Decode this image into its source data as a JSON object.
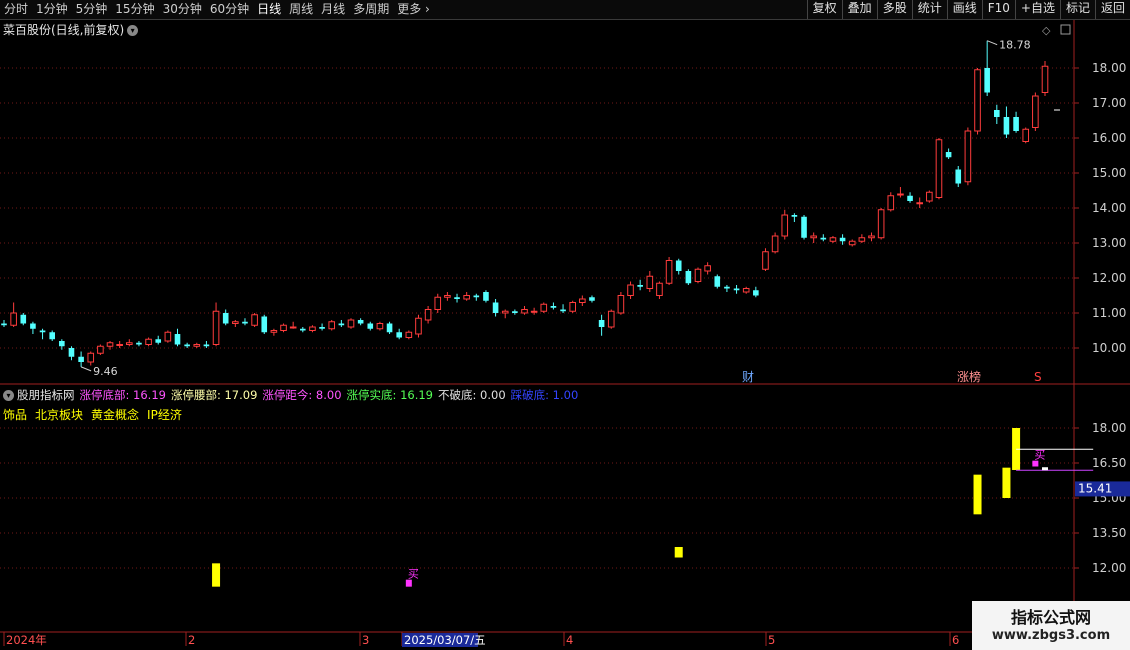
{
  "toolbar": {
    "left": [
      "分时",
      "1分钟",
      "5分钟",
      "15分钟",
      "30分钟",
      "60分钟",
      "日线",
      "周线",
      "月线",
      "多周期",
      "更多"
    ],
    "active": "日线",
    "right": [
      "复权",
      "叠加",
      "多股",
      "统计",
      "画线",
      "F10",
      "+自选",
      "标记",
      "返回"
    ]
  },
  "chart_title": "菜百股份(日线,前复权)",
  "indicator": {
    "name": "股朋指标网",
    "items": [
      {
        "label": "涨停底部:",
        "value": "16.19",
        "color": "#ff55ff"
      },
      {
        "label": "涨停腰部:",
        "value": "17.09",
        "color": "#ffffaa"
      },
      {
        "label": "涨停距今:",
        "value": "8.00",
        "color": "#ff55ff"
      },
      {
        "label": "涨停实底:",
        "value": "16.19",
        "color": "#55ff55"
      },
      {
        "label": "不破底:",
        "value": "0.00",
        "color": "#e0e0e0"
      },
      {
        "label": "踩破底:",
        "value": "1.00",
        "color": "#3344ff"
      }
    ]
  },
  "tags": [
    "饰品",
    "北京板块",
    "黄金概念",
    "IP经济"
  ],
  "annotations": {
    "high": "18.78",
    "low": "9.46",
    "cai": "财",
    "zhangbang": "涨榜",
    "s": "S",
    "buy": "买",
    "current_value": "15.41"
  },
  "watermark": {
    "title": "指标公式网",
    "url": "www.zbgs3.com"
  },
  "chart_data": [
    {
      "type": "candlestick",
      "title": "菜百股份(日线,前复权)",
      "price_axis": {
        "min": 9.4,
        "max": 18.8,
        "ticks": [
          10.0,
          11.0,
          12.0,
          13.0,
          14.0,
          15.0,
          16.0,
          17.0,
          18.0
        ]
      },
      "date_labels": [
        "2024年",
        "2",
        "3",
        "2025/03/07/五",
        "4",
        "5",
        "6"
      ],
      "colors": {
        "up": "#ff3c3c",
        "down": "#54ffff"
      },
      "candles": [
        [
          10.7,
          10.8,
          10.6,
          10.65
        ],
        [
          10.65,
          11.3,
          10.6,
          11.0
        ],
        [
          10.95,
          11.0,
          10.65,
          10.7
        ],
        [
          10.7,
          10.75,
          10.4,
          10.55
        ],
        [
          10.5,
          10.55,
          10.25,
          10.45
        ],
        [
          10.45,
          10.5,
          10.2,
          10.25
        ],
        [
          10.2,
          10.25,
          9.95,
          10.05
        ],
        [
          10.0,
          10.05,
          9.65,
          9.75
        ],
        [
          9.75,
          9.9,
          9.46,
          9.6
        ],
        [
          9.6,
          9.9,
          9.5,
          9.85
        ],
        [
          9.85,
          10.1,
          9.8,
          10.05
        ],
        [
          10.05,
          10.2,
          9.95,
          10.15
        ],
        [
          10.1,
          10.2,
          10.0,
          10.1
        ],
        [
          10.1,
          10.25,
          10.05,
          10.15
        ],
        [
          10.15,
          10.2,
          10.05,
          10.1
        ],
        [
          10.1,
          10.3,
          10.05,
          10.25
        ],
        [
          10.25,
          10.35,
          10.1,
          10.15
        ],
        [
          10.2,
          10.5,
          10.15,
          10.45
        ],
        [
          10.4,
          10.55,
          10.05,
          10.1
        ],
        [
          10.1,
          10.15,
          10.0,
          10.05
        ],
        [
          10.05,
          10.15,
          10.0,
          10.1
        ],
        [
          10.1,
          10.2,
          10.0,
          10.05
        ],
        [
          10.1,
          11.3,
          10.05,
          11.05
        ],
        [
          11.0,
          11.1,
          10.65,
          10.7
        ],
        [
          10.7,
          10.8,
          10.6,
          10.75
        ],
        [
          10.75,
          10.85,
          10.65,
          10.7
        ],
        [
          10.65,
          11.0,
          10.6,
          10.95
        ],
        [
          10.9,
          10.95,
          10.4,
          10.45
        ],
        [
          10.45,
          10.55,
          10.35,
          10.5
        ],
        [
          10.5,
          10.7,
          10.45,
          10.65
        ],
        [
          10.6,
          10.75,
          10.55,
          10.6
        ],
        [
          10.55,
          10.6,
          10.45,
          10.5
        ],
        [
          10.5,
          10.65,
          10.45,
          10.6
        ],
        [
          10.6,
          10.7,
          10.5,
          10.55
        ],
        [
          10.55,
          10.8,
          10.5,
          10.75
        ],
        [
          10.7,
          10.8,
          10.6,
          10.65
        ],
        [
          10.6,
          10.85,
          10.55,
          10.8
        ],
        [
          10.8,
          10.85,
          10.65,
          10.7
        ],
        [
          10.7,
          10.75,
          10.5,
          10.55
        ],
        [
          10.55,
          10.75,
          10.5,
          10.7
        ],
        [
          10.7,
          10.75,
          10.4,
          10.45
        ],
        [
          10.45,
          10.55,
          10.25,
          10.3
        ],
        [
          10.3,
          10.5,
          10.25,
          10.45
        ],
        [
          10.4,
          10.95,
          10.3,
          10.85
        ],
        [
          10.8,
          11.2,
          10.7,
          11.1
        ],
        [
          11.1,
          11.55,
          11.0,
          11.45
        ],
        [
          11.45,
          11.6,
          11.35,
          11.5
        ],
        [
          11.45,
          11.55,
          11.3,
          11.4
        ],
        [
          11.4,
          11.6,
          11.35,
          11.5
        ],
        [
          11.5,
          11.55,
          11.35,
          11.45
        ],
        [
          11.6,
          11.65,
          11.3,
          11.35
        ],
        [
          11.3,
          11.4,
          10.9,
          11.0
        ],
        [
          11.0,
          11.1,
          10.85,
          11.05
        ],
        [
          11.05,
          11.1,
          10.95,
          11.0
        ],
        [
          11.0,
          11.2,
          10.95,
          11.1
        ],
        [
          11.05,
          11.15,
          10.95,
          11.05
        ],
        [
          11.05,
          11.3,
          11.0,
          11.25
        ],
        [
          11.2,
          11.3,
          11.1,
          11.15
        ],
        [
          11.1,
          11.25,
          11.0,
          11.05
        ],
        [
          11.05,
          11.35,
          11.0,
          11.3
        ],
        [
          11.3,
          11.5,
          11.2,
          11.4
        ],
        [
          11.45,
          11.5,
          11.3,
          11.35
        ],
        [
          10.8,
          10.95,
          10.35,
          10.6
        ],
        [
          10.6,
          11.1,
          10.55,
          11.05
        ],
        [
          11.0,
          11.6,
          10.95,
          11.5
        ],
        [
          11.5,
          11.9,
          11.4,
          11.8
        ],
        [
          11.8,
          11.95,
          11.65,
          11.75
        ],
        [
          11.7,
          12.2,
          11.6,
          12.05
        ],
        [
          11.5,
          11.9,
          11.4,
          11.85
        ],
        [
          11.85,
          12.6,
          11.8,
          12.5
        ],
        [
          12.5,
          12.55,
          12.1,
          12.2
        ],
        [
          12.2,
          12.25,
          11.8,
          11.85
        ],
        [
          11.9,
          12.3,
          11.85,
          12.25
        ],
        [
          12.2,
          12.45,
          12.1,
          12.35
        ],
        [
          12.05,
          12.1,
          11.7,
          11.75
        ],
        [
          11.75,
          11.8,
          11.6,
          11.7
        ],
        [
          11.7,
          11.8,
          11.55,
          11.65
        ],
        [
          11.6,
          11.75,
          11.55,
          11.7
        ],
        [
          11.65,
          11.75,
          11.45,
          11.5
        ],
        [
          12.25,
          12.85,
          12.2,
          12.75
        ],
        [
          12.75,
          13.3,
          12.7,
          13.2
        ],
        [
          13.2,
          13.95,
          13.1,
          13.8
        ],
        [
          13.8,
          13.85,
          13.6,
          13.75
        ],
        [
          13.75,
          13.8,
          13.1,
          13.15
        ],
        [
          13.15,
          13.3,
          13.0,
          13.2
        ],
        [
          13.15,
          13.25,
          13.05,
          13.1
        ],
        [
          13.05,
          13.2,
          13.0,
          13.15
        ],
        [
          13.15,
          13.25,
          12.95,
          13.05
        ],
        [
          12.95,
          13.1,
          12.9,
          13.05
        ],
        [
          13.05,
          13.25,
          13.0,
          13.15
        ],
        [
          13.15,
          13.3,
          13.05,
          13.2
        ],
        [
          13.15,
          14.0,
          13.1,
          13.95
        ],
        [
          13.95,
          14.45,
          13.9,
          14.35
        ],
        [
          14.4,
          14.6,
          14.3,
          14.4
        ],
        [
          14.35,
          14.45,
          14.15,
          14.2
        ],
        [
          14.15,
          14.3,
          14.0,
          14.15
        ],
        [
          14.2,
          14.5,
          14.15,
          14.45
        ],
        [
          14.3,
          16.0,
          14.25,
          15.95
        ],
        [
          15.6,
          15.7,
          15.4,
          15.45
        ],
        [
          15.1,
          15.2,
          14.6,
          14.7
        ],
        [
          14.75,
          16.3,
          14.65,
          16.2
        ],
        [
          16.2,
          18.0,
          16.1,
          17.95
        ],
        [
          18.0,
          18.78,
          17.2,
          17.3
        ],
        [
          16.8,
          16.95,
          16.4,
          16.6
        ],
        [
          16.6,
          16.9,
          16.0,
          16.1
        ],
        [
          16.6,
          16.75,
          16.15,
          16.2
        ],
        [
          15.9,
          16.3,
          15.85,
          16.25
        ],
        [
          16.3,
          17.3,
          16.2,
          17.2
        ],
        [
          17.3,
          18.2,
          17.2,
          18.05
        ]
      ]
    },
    {
      "type": "bar",
      "axis": {
        "min": 10.9,
        "max": 19.8,
        "ticks": [
          12.0,
          13.5,
          15.0,
          16.5,
          18.0
        ]
      },
      "bars": [
        {
          "index": 22,
          "low": 11.2,
          "high": 12.2,
          "color": "#ffff00"
        },
        {
          "index": 70,
          "low": 12.45,
          "high": 12.9,
          "color": "#ffff00"
        },
        {
          "index": 101,
          "low": 14.3,
          "high": 16.0,
          "color": "#ffff00"
        },
        {
          "index": 104,
          "low": 15.0,
          "high": 16.3,
          "color": "#ffff00"
        },
        {
          "index": 105,
          "low": 16.2,
          "high": 18.0,
          "color": "#ffff00"
        }
      ],
      "markers": [
        {
          "index": 42,
          "low": 11.2,
          "high": 11.5,
          "color": "#ff33ff",
          "label": "买"
        },
        {
          "index": 107,
          "low": 16.35,
          "high": 16.6,
          "color": "#ff33ff",
          "label": "买"
        }
      ],
      "lines": [
        {
          "from": 105,
          "to": 113,
          "value": 17.09,
          "color": "#ffffff"
        },
        {
          "from": 105,
          "to": 113,
          "value": 16.19,
          "color": "#cc44ff"
        }
      ]
    }
  ]
}
